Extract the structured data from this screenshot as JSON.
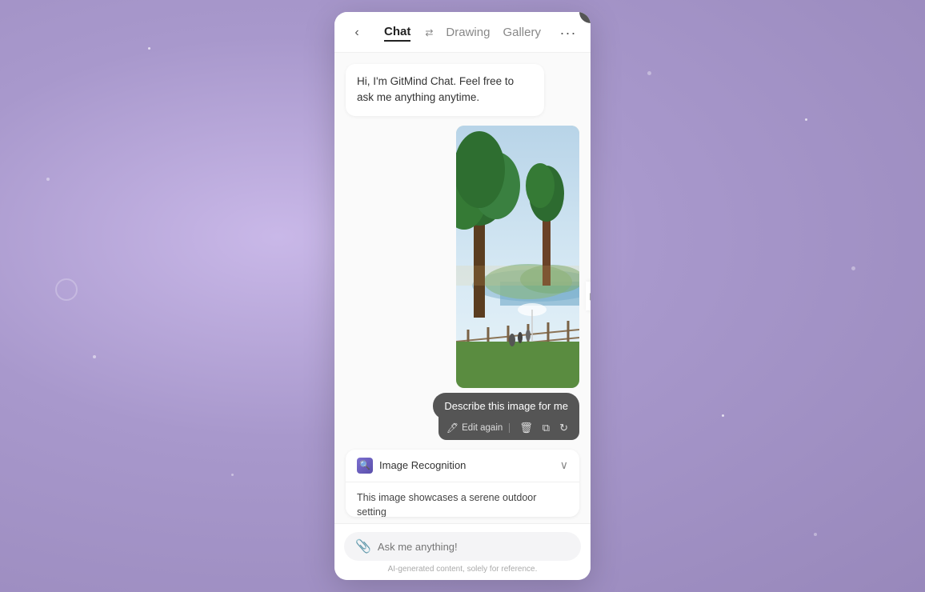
{
  "background": {
    "color": "#b8a8d9"
  },
  "panel": {
    "close_label": "✕"
  },
  "header": {
    "back_icon": "‹",
    "tabs": [
      {
        "label": "Chat",
        "active": true
      },
      {
        "label": "Drawing",
        "active": false
      },
      {
        "label": "Gallery",
        "active": false
      }
    ],
    "tab_icon": "⇄",
    "more_icon": "···",
    "expand_icon": "▶"
  },
  "welcome_message": "Hi, I'm GitMind Chat. Feel free to ask me anything anytime.",
  "user_message": {
    "text": "Describe this image for me",
    "actions": {
      "edit_label": "Edit again",
      "edit_icon": "🖊",
      "delete_icon": "🗑",
      "copy_icon": "⧉",
      "refresh_icon": "↻"
    }
  },
  "ai_response": {
    "label": "Image Recognition",
    "label_icon": "🔍",
    "chevron": "∨",
    "body": "This image showcases a serene outdoor setting"
  },
  "input": {
    "placeholder": "Ask me anything!",
    "attach_icon": "📎",
    "disclaimer": "AI-generated content, solely for reference."
  }
}
